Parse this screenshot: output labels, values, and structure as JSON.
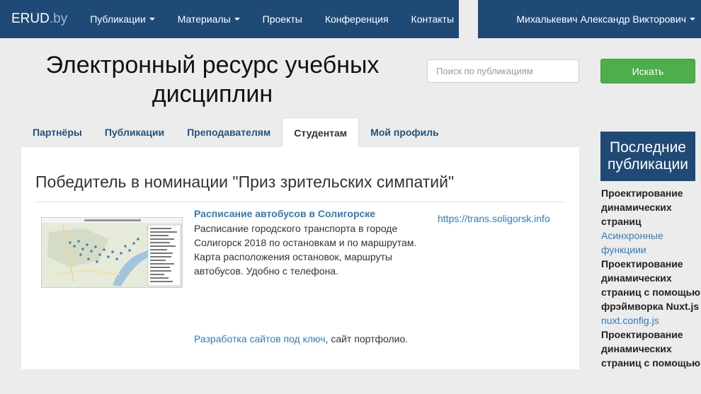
{
  "navbar": {
    "brand_main": "ERUD",
    "brand_suffix": ".by",
    "items": [
      {
        "label": "Публикации",
        "dropdown": true
      },
      {
        "label": "Материалы",
        "dropdown": true
      },
      {
        "label": "Проекты",
        "dropdown": false
      },
      {
        "label": "Конференция",
        "dropdown": false
      },
      {
        "label": "Контакты",
        "dropdown": false
      }
    ],
    "user": "Михалькевич Александр Викторович"
  },
  "header": {
    "title": "Электронный ресурс учебных дисциплин",
    "search_placeholder": "Поиск по публикациям",
    "search_button": "Искать"
  },
  "tabs": [
    {
      "label": "Партнёры",
      "active": false
    },
    {
      "label": "Публикации",
      "active": false
    },
    {
      "label": "Преподавателям",
      "active": false
    },
    {
      "label": "Студентам",
      "active": true
    },
    {
      "label": "Мой профиль",
      "active": false
    }
  ],
  "main": {
    "section_title": "Победитель в номинации \"Приз зрительских симпатий\"",
    "publication": {
      "title": "Расписание автобусов в Солигорске",
      "description": "Расписание городского транспорта в городе Солигорск 2018 по остановкам и по маршрутам. Карта расположения остановок, маршруты автобусов. Удобно с телефона.",
      "link": "https://trans.soligorsk.info"
    },
    "footer_link": "Разработка сайтов под ключ",
    "footer_text": ", сайт портфолио."
  },
  "sidebar": {
    "title": "Последние публикации",
    "entries": [
      {
        "bold": "Проектирование динамических страниц",
        "link": "Асинхронные функциии"
      },
      {
        "bold": "Проектирование динамических страниц с помощью фрэймворка Nuxt.js",
        "link": "nuxt.config.js"
      },
      {
        "bold": "Проектирование динамических страниц с помощью",
        "link": ""
      }
    ]
  },
  "colors": {
    "navbar": "#1f4a75",
    "link": "#337ab7",
    "button": "#4cae4c",
    "background": "#ececec"
  }
}
